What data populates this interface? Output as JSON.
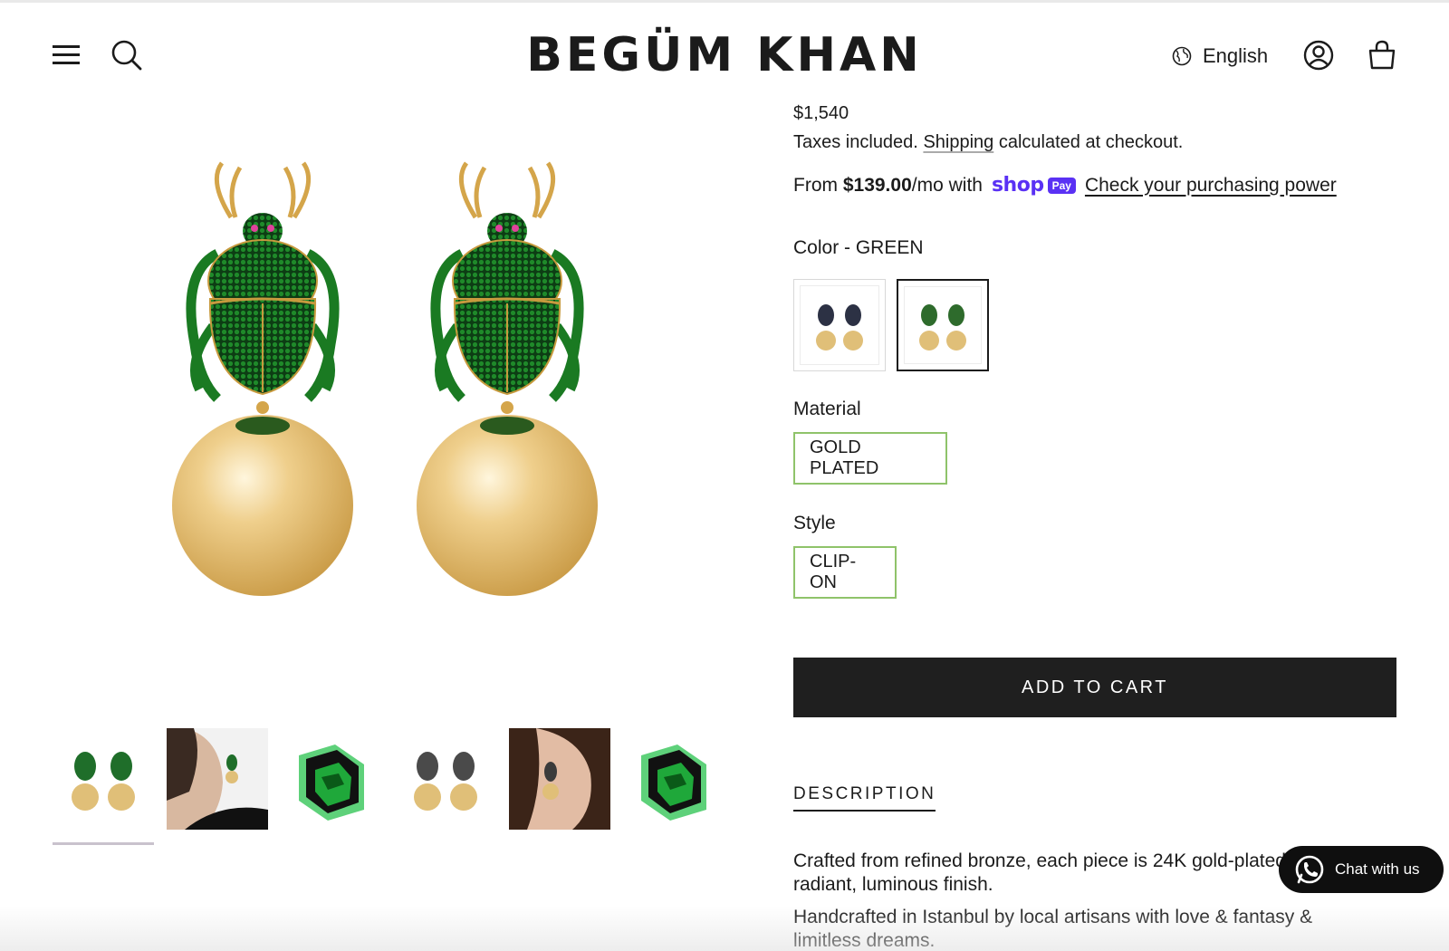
{
  "header": {
    "logo": "BEGÜM KHAN",
    "language": "English"
  },
  "product": {
    "price": "$1,540",
    "tax_prefix": "Taxes included.",
    "tax_link": "Shipping",
    "tax_suffix": "calculated at checkout.",
    "installment_from": "From",
    "installment_amount": "$139.00",
    "installment_suffix": "/mo with",
    "shop_pay_word": "shop",
    "shop_pay_badge": "Pay",
    "check_power_link": "Check your purchasing power",
    "color_label": "Color - GREEN",
    "swatches": [
      {
        "name": "black",
        "color": "#2c3144"
      },
      {
        "name": "green",
        "color": "#2e6b2c",
        "selected": true
      }
    ],
    "material_label": "Material",
    "material_value": "GOLD PLATED",
    "style_label": "Style",
    "style_value": "CLIP-ON",
    "add_to_cart": "ADD TO CART",
    "description_tab": "DESCRIPTION",
    "description_p1": "Crafted from refined bronze, each piece is 24K gold-plated for a radiant, luminous finish.",
    "description_p2": "Handcrafted in Istanbul by local artisans with love & fantasy & limitless dreams."
  },
  "gallery": {
    "thumbnails": [
      "green-earrings",
      "model-green",
      "green-box",
      "black-earrings",
      "model-black",
      "green-box"
    ],
    "active_index": 0
  },
  "chat": {
    "label": "Chat with us"
  },
  "colors": {
    "emerald": "#1f7a1f",
    "gold": "#d9b86b",
    "pill_border": "#8fc36a",
    "shop_pay": "#5a31f4"
  }
}
